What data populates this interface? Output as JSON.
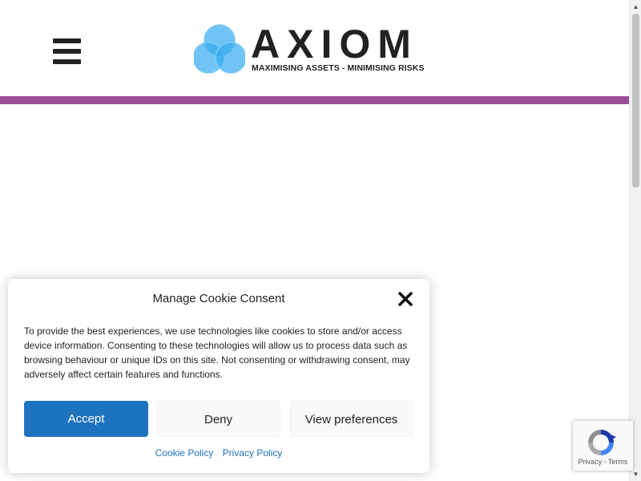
{
  "colors": {
    "accent_bar": "#9b4f96",
    "accept_button": "#1e73be",
    "link": "#1e73be",
    "logo_circles": [
      "#33aaf0",
      "#5bbcf5",
      "#83cdf8"
    ]
  },
  "header": {
    "menu_icon": "hamburger-icon",
    "logo": {
      "word": "AXIOM",
      "tagline": "MAXIMISING ASSETS - MINIMISING RISKS"
    }
  },
  "cookie_banner": {
    "title": "Manage Cookie Consent",
    "close_icon": "close-icon",
    "body": "To provide the best experiences, we use technologies like cookies to store and/or access device information. Consenting to these technologies will allow us to process data such as browsing behaviour or unique IDs on this site. Not consenting or withdrawing consent, may adversely affect certain features and functions.",
    "buttons": {
      "accept": "Accept",
      "deny": "Deny",
      "preferences": "View preferences"
    },
    "links": {
      "cookie_policy": "Cookie Policy",
      "privacy_policy": "Privacy Policy"
    }
  },
  "recaptcha": {
    "icon": "recaptcha-icon",
    "privacy": "Privacy",
    "separator": " - ",
    "terms": "Terms"
  },
  "scrollbar": {
    "up_arrow": "▲",
    "down_arrow": "▼"
  }
}
